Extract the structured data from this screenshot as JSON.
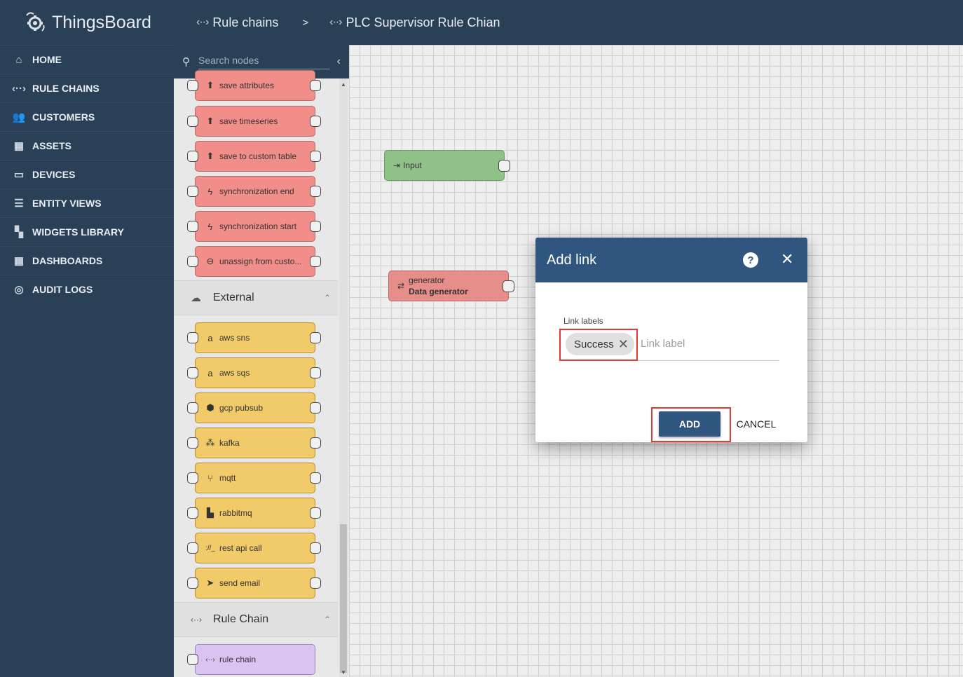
{
  "app": {
    "name": "ThingsBoard"
  },
  "breadcrumb": {
    "item1": "Rule chains",
    "separator": ">",
    "item2": "PLC Supervisor Rule Chian"
  },
  "sidebar": {
    "items": [
      {
        "label": "HOME",
        "icon": "home-icon"
      },
      {
        "label": "RULE CHAINS",
        "icon": "rule-chain-icon"
      },
      {
        "label": "CUSTOMERS",
        "icon": "customers-icon"
      },
      {
        "label": "ASSETS",
        "icon": "assets-icon"
      },
      {
        "label": "DEVICES",
        "icon": "devices-icon"
      },
      {
        "label": "ENTITY VIEWS",
        "icon": "entity-views-icon"
      },
      {
        "label": "WIDGETS LIBRARY",
        "icon": "widgets-icon"
      },
      {
        "label": "DASHBOARDS",
        "icon": "dashboards-icon"
      },
      {
        "label": "AUDIT LOGS",
        "icon": "audit-logs-icon"
      }
    ]
  },
  "library": {
    "search_placeholder": "Search nodes",
    "action_nodes": [
      "save attributes",
      "save timeseries",
      "save to custom table",
      "synchronization end",
      "synchronization start",
      "unassign from custo..."
    ],
    "external_title": "External",
    "external_nodes": [
      "aws sns",
      "aws sqs",
      "gcp pubsub",
      "kafka",
      "mqtt",
      "rabbitmq",
      "rest api call",
      "send email"
    ],
    "rulechain_title": "Rule Chain",
    "rulechain_nodes": [
      "rule chain"
    ]
  },
  "canvas": {
    "input_node": "Input",
    "generator_node": {
      "type": "generator",
      "name": "Data generator"
    }
  },
  "dialog": {
    "title": "Add link",
    "field_label": "Link labels",
    "chip": "Success",
    "placeholder": "Link label",
    "add_label": "ADD",
    "cancel_label": "CANCEL"
  },
  "colors": {
    "primary": "#305680",
    "sidebar": "#2a4057",
    "highlight": "#e53935"
  }
}
